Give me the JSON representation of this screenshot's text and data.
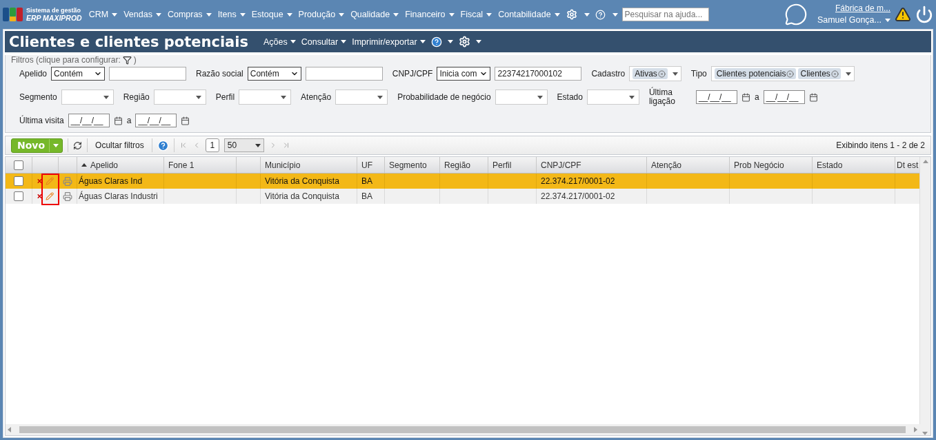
{
  "nav": {
    "logo": {
      "line1": "Sistema de gestão",
      "line2": "ERP MAXIPROD"
    },
    "menus": [
      "CRM",
      "Vendas",
      "Compras",
      "Itens",
      "Estoque",
      "Produção",
      "Qualidade",
      "Financeiro",
      "Fiscal",
      "Contabilidade"
    ],
    "search": {
      "placeholder": "Pesquisar na ajuda..."
    },
    "company": "Fábrica de m...",
    "user": "Samuel Gonça...",
    "alert": true
  },
  "page": {
    "title": "Clientes e clientes potenciais",
    "actions": [
      "Ações",
      "Consultar",
      "Imprimir/exportar"
    ]
  },
  "filters": {
    "legend": "Filtros (clique para configurar:",
    "legend_end": ")",
    "fields": [
      {
        "kind": "text",
        "label": "Apelido",
        "operator": "Contém"
      },
      {
        "kind": "text",
        "label": "Razão social",
        "operator": "Contém"
      },
      {
        "kind": "text",
        "label": "CNPJ/CPF",
        "operator": "Inicia com",
        "value": "22374217000102"
      },
      {
        "kind": "tags",
        "label": "Cadastro",
        "tags": [
          "Ativas"
        ]
      },
      {
        "kind": "tags",
        "label": "Tipo",
        "tags": [
          "Clientes potenciais",
          "Clientes"
        ]
      },
      {
        "kind": "select",
        "label": "Segmento",
        "new_line": true
      },
      {
        "kind": "select",
        "label": "Região"
      },
      {
        "kind": "select",
        "label": "Perfil"
      },
      {
        "kind": "select",
        "label": "Atenção"
      },
      {
        "kind": "select",
        "label": "Probabilidade de negócio"
      },
      {
        "kind": "select",
        "label": "Estado"
      },
      {
        "kind": "date-range",
        "label": "Última ligação",
        "from": "__/__/__",
        "separator": "a",
        "to": "__/__/__"
      },
      {
        "kind": "date-range",
        "label": "Última visita",
        "from": "__/__/__",
        "separator": "a",
        "to": "__/__/__",
        "new_line": true
      }
    ]
  },
  "toolbar": {
    "new_button": "Novo",
    "hide_filters": "Ocultar filtros",
    "page": "1",
    "page_size": "50",
    "status": "Exibindo itens 1 - 2 de 2"
  },
  "table": {
    "select_all": {
      "checked": false
    },
    "columns": [
      {
        "label": "Apelido",
        "sorted": true
      },
      {
        "label": "Fone 1"
      },
      {},
      {
        "label": "Município"
      },
      {
        "label": "UF"
      },
      {
        "label": "Segmento"
      },
      {
        "label": "Região"
      },
      {
        "label": "Perfil"
      },
      {
        "label": "CNPJ/CPF"
      },
      {
        "label": "Atenção"
      },
      {
        "label": "Prob Negócio"
      },
      {
        "label": "Estado"
      },
      {
        "label": "Dt est"
      }
    ],
    "rows": [
      {
        "selected": true,
        "checked": false,
        "cells": [
          "Águas Claras Ind",
          null,
          null,
          "Vitória da Conquista",
          "BA",
          null,
          null,
          null,
          "22.374.217/0001-02",
          null,
          null,
          null,
          null
        ]
      },
      {
        "selected": false,
        "checked": false,
        "cells": [
          "Águas Claras Industri",
          null,
          null,
          "Vitória da Conquista",
          "BA",
          null,
          null,
          null,
          "22.374.217/0001-02",
          null,
          null,
          null,
          null
        ]
      }
    ],
    "edit_highlight": true
  }
}
